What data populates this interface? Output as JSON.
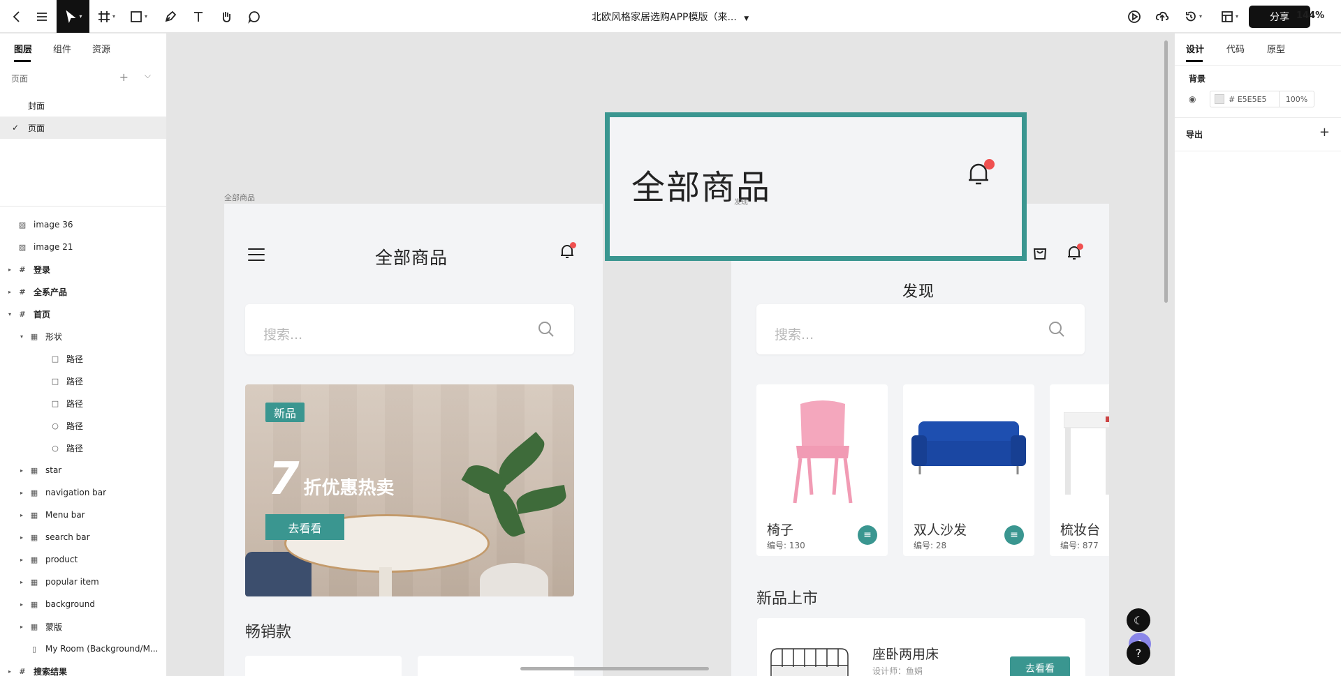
{
  "topbar": {
    "doc_title": "北欧风格家居选购APP模版（来...",
    "share_label": "分享",
    "zoom": "144%",
    "tools": [
      "back-icon",
      "menu-icon",
      "move-tool-icon",
      "frame-tool-icon",
      "shape-tool-icon",
      "pen-tool-icon",
      "text-tool-icon",
      "hand-tool-icon",
      "comment-tool-icon"
    ],
    "right_tools": [
      "play-icon",
      "upload-icon",
      "history-icon",
      "layout-icon"
    ]
  },
  "left_panel": {
    "tabs": [
      "图层",
      "组件",
      "资源"
    ],
    "pages_label": "页面",
    "pages": [
      {
        "label": "封面",
        "selected": false
      },
      {
        "label": "页面",
        "selected": true
      }
    ],
    "layers": [
      {
        "name": "image 36",
        "type": "image",
        "level": 0,
        "bold": false,
        "expand": ""
      },
      {
        "name": "image 21",
        "type": "image",
        "level": 0,
        "bold": false,
        "expand": ""
      },
      {
        "name": "登录",
        "type": "frame",
        "level": 0,
        "bold": true,
        "expand": "▸"
      },
      {
        "name": "全系产品",
        "type": "frame",
        "level": 0,
        "bold": true,
        "expand": "▸"
      },
      {
        "name": "首页",
        "type": "frame",
        "level": 0,
        "bold": true,
        "expand": "▾"
      },
      {
        "name": "形状",
        "type": "group",
        "level": 1,
        "bold": false,
        "expand": "▾"
      },
      {
        "name": "路径",
        "type": "rect",
        "level": 2,
        "bold": false,
        "expand": ""
      },
      {
        "name": "路径",
        "type": "rect",
        "level": 2,
        "bold": false,
        "expand": ""
      },
      {
        "name": "路径",
        "type": "rect",
        "level": 2,
        "bold": false,
        "expand": ""
      },
      {
        "name": "路径",
        "type": "circle",
        "level": 2,
        "bold": false,
        "expand": ""
      },
      {
        "name": "路径",
        "type": "circle",
        "level": 2,
        "bold": false,
        "expand": ""
      },
      {
        "name": "star",
        "type": "group",
        "level": 1,
        "bold": false,
        "expand": "▸"
      },
      {
        "name": "navigation bar",
        "type": "group",
        "level": 1,
        "bold": false,
        "expand": "▸"
      },
      {
        "name": "Menu bar",
        "type": "group",
        "level": 1,
        "bold": false,
        "expand": "▸"
      },
      {
        "name": "search bar",
        "type": "group",
        "level": 1,
        "bold": false,
        "expand": "▸"
      },
      {
        "name": "product",
        "type": "group",
        "level": 1,
        "bold": false,
        "expand": "▸"
      },
      {
        "name": "popular item",
        "type": "group",
        "level": 1,
        "bold": false,
        "expand": "▸"
      },
      {
        "name": "background",
        "type": "group",
        "level": 1,
        "bold": false,
        "expand": "▸"
      },
      {
        "name": "蒙版",
        "type": "group",
        "level": 1,
        "bold": false,
        "expand": "▸"
      },
      {
        "name": "My Room (Background/M...",
        "type": "bar",
        "level": 1,
        "bold": false,
        "expand": ""
      },
      {
        "name": "搜索结果",
        "type": "frame",
        "level": 0,
        "bold": true,
        "expand": "▸"
      }
    ]
  },
  "canvas": {
    "frame_label": "全部商品",
    "artboard1": {
      "title": "全部商品",
      "search_placeholder": "搜索...",
      "banner": {
        "badge": "新品",
        "big_number": "7",
        "promo_text": "折优惠热卖",
        "button": "去看看"
      },
      "section_title": "畅销款"
    },
    "artboard2": {
      "title": "发现",
      "search_placeholder": "搜索...",
      "products": [
        {
          "name": "椅子",
          "number": "编号: 130"
        },
        {
          "name": "双人沙发",
          "number": "编号: 28"
        },
        {
          "name": "梳妆台",
          "number": "编号: 877"
        }
      ],
      "section_title": "新品上市",
      "new_item": {
        "name": "座卧两用床",
        "sub": "设计师：鱼娟",
        "button": "去看看"
      }
    },
    "zoom_overlay": {
      "title": "全部商品",
      "sub": "发现"
    }
  },
  "right_panel": {
    "tabs": [
      "设计",
      "代码",
      "原型"
    ],
    "background_label": "背景",
    "color_hex": "# E5E5E5",
    "opacity": "100%",
    "export_label": "导出"
  },
  "colors": {
    "accent": "#3a9690",
    "notification": "#f05050",
    "canvas_bg": "#E5E5E5",
    "dark_button": "#111111"
  }
}
